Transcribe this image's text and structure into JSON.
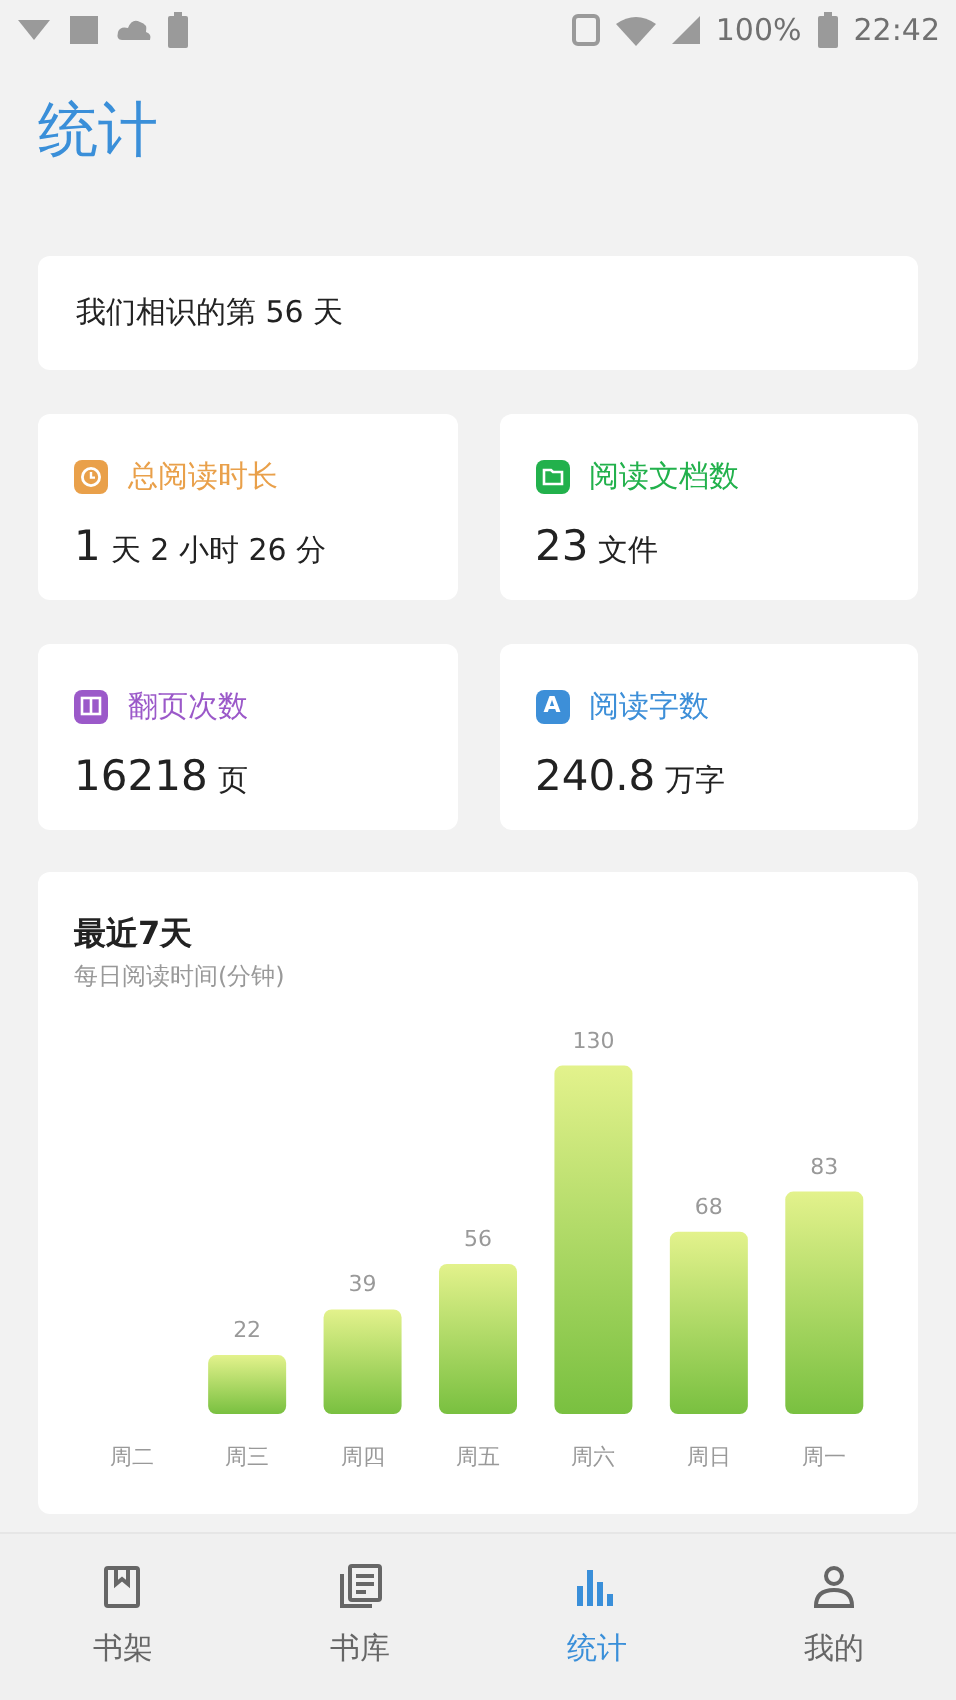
{
  "status_bar": {
    "battery": "100%",
    "time": "22:42"
  },
  "title": "统计",
  "intro": "我们相识的第 56 天",
  "stats": [
    {
      "kind": "clock",
      "color": "#e9a04a",
      "label": "总阅读时长",
      "value": "1",
      "unit": "天 2 小时 26 分"
    },
    {
      "kind": "folder",
      "color": "#22b14c",
      "label": "阅读文档数",
      "value": "23",
      "unit": "文件"
    },
    {
      "kind": "book",
      "color": "#9b59c9",
      "label": "翻页次数",
      "value": "16218",
      "unit": "页"
    },
    {
      "kind": "letter",
      "icon_text": "A",
      "color": "#3d8fd8",
      "label": "阅读字数",
      "value": "240.8",
      "unit": "万字"
    }
  ],
  "chart_card": {
    "title": "最近7天",
    "subtitle": "每日阅读时间(分钟)",
    "chart_data": {
      "type": "bar",
      "categories": [
        "周二",
        "周三",
        "周四",
        "周五",
        "周六",
        "周日",
        "周一"
      ],
      "values": [
        null,
        22,
        39,
        56,
        130,
        68,
        83
      ],
      "data_labels": true
    }
  },
  "nav": [
    {
      "kind": "book",
      "label": "书架",
      "selected": false
    },
    {
      "kind": "library",
      "label": "书库",
      "selected": false
    },
    {
      "kind": "stats",
      "label": "统计",
      "selected": true
    },
    {
      "kind": "person",
      "label": "我的",
      "selected": false
    }
  ]
}
